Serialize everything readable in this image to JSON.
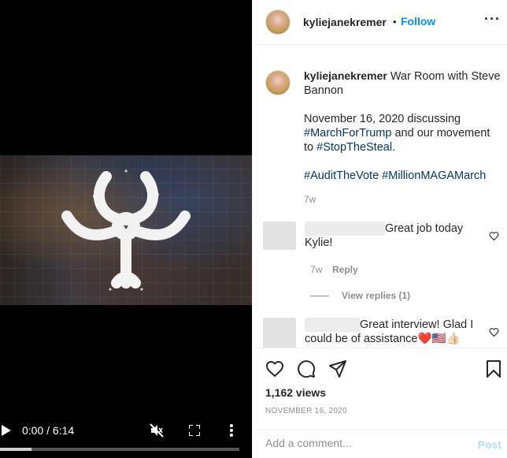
{
  "video": {
    "time_display": "0:00 / 6:14",
    "progress": 0.13
  },
  "header": {
    "username": "kyliejanekremer",
    "separator": "•",
    "follow_label": "Follow",
    "more_label": "···"
  },
  "caption": {
    "username": "kyliejanekremer",
    "line1": "War Room with Steve Bannon",
    "p2_text1": "November 16, 2020 discussing ",
    "p2_tag1": "#MarchForTrump",
    "p2_text2": " and our movement to ",
    "p2_tag2": "#StopTheSteal",
    "p2_text3": ".",
    "tag3": "#AuditTheVote",
    "tag4": "#MillionMAGAMarch",
    "time": "7w"
  },
  "comments": [
    {
      "text": "Great job today Kylie!",
      "time": "7w",
      "reply_label": "Reply",
      "view_replies_label": "View replies (1)"
    },
    {
      "text": "Great interview! Glad I could be of assistance❤️🇺🇸👍🏻"
    }
  ],
  "post_meta": {
    "views": "1,162 views",
    "date": "NOVEMBER 16, 2020"
  },
  "add_comment": {
    "placeholder": "Add a comment...",
    "post_label": "Post"
  },
  "icons": {
    "play": "play-icon",
    "mute": "volume-muted-icon",
    "fullscreen": "fullscreen-icon",
    "video_more": "more-vertical-icon",
    "like": "heart-icon",
    "comment": "comment-icon",
    "share": "send-icon",
    "save": "bookmark-icon"
  },
  "colors": {
    "link": "#0095f6",
    "hashtag": "#00376b",
    "muted": "#8e8e8e"
  }
}
